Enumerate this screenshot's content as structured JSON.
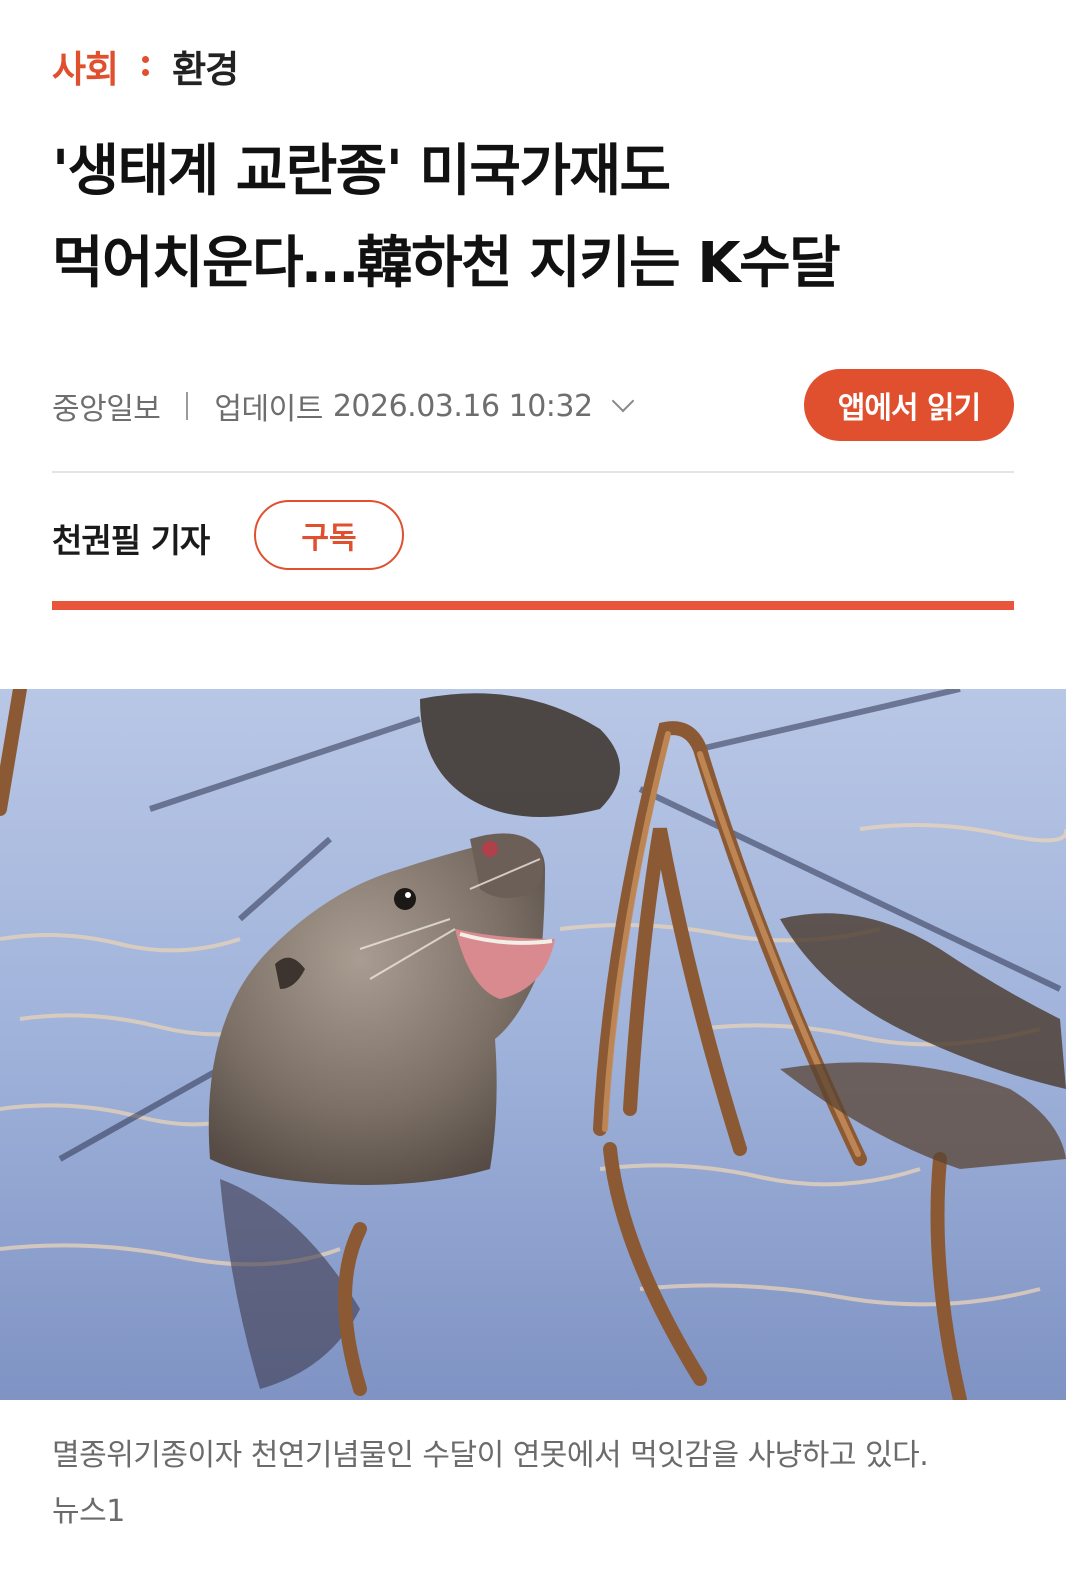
{
  "breadcrumb": {
    "section": "사회",
    "subsection": "환경"
  },
  "headline": {
    "line1": "'생태계 교란종' 미국가재도",
    "line2": "먹어치운다…韓하천 지키는 K수달"
  },
  "meta": {
    "publisher": "중앙일보",
    "updated_label": "업데이트",
    "updated_datetime": "2026.03.16 10:32",
    "app_button_label": "앱에서 읽기"
  },
  "reporter": {
    "name": "천권필 기자",
    "subscribe_label": "구독"
  },
  "photo": {
    "caption_line1": "멸종위기종이자 천연기념물인 수달이 연못에서 먹잇감을 사냥하고 있다.",
    "caption_line2": "뉴스1"
  },
  "colors": {
    "accent": "#e0502f",
    "rule": "#e8553a",
    "meta_text": "#6e6e6e"
  }
}
